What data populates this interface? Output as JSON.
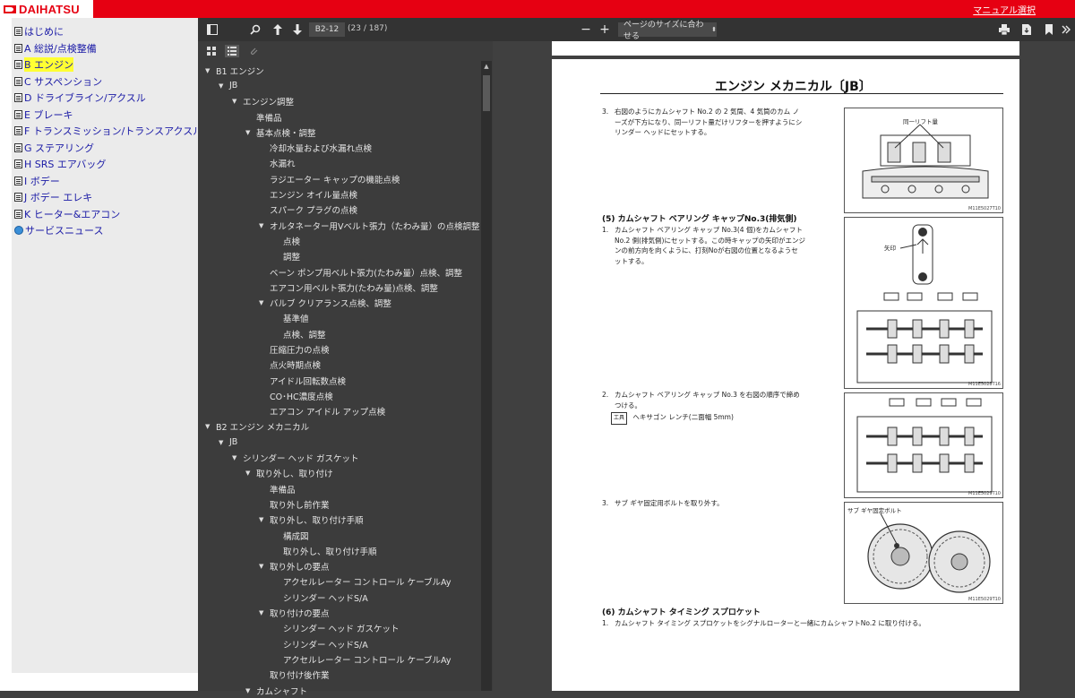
{
  "header": {
    "brand": "DAIHATSU",
    "manual_select": "マニュアル選択"
  },
  "left_nav": {
    "items": [
      {
        "label": "はじめに",
        "icon": "doc-icon",
        "active": false
      },
      {
        "label": "A 総説/点検整備",
        "icon": "doc-icon",
        "active": false
      },
      {
        "label": "B エンジン",
        "icon": "doc-icon",
        "active": true
      },
      {
        "label": "C サスペンション",
        "icon": "doc-icon",
        "active": false
      },
      {
        "label": "D ドライブライン/アクスル",
        "icon": "doc-icon",
        "active": false
      },
      {
        "label": "E ブレーキ",
        "icon": "doc-icon",
        "active": false
      },
      {
        "label": "F トランスミッション/トランスアクスル",
        "icon": "doc-icon",
        "active": false
      },
      {
        "label": "G ステアリング",
        "icon": "doc-icon",
        "active": false
      },
      {
        "label": "H SRS エアバッグ",
        "icon": "doc-icon",
        "active": false
      },
      {
        "label": "I ボデー",
        "icon": "doc-icon",
        "active": false
      },
      {
        "label": "J ボデー エレキ",
        "icon": "doc-icon",
        "active": false
      },
      {
        "label": "K ヒーター&エアコン",
        "icon": "doc-icon",
        "active": false
      },
      {
        "label": "サービスニュース",
        "icon": "globe-icon",
        "active": false
      }
    ]
  },
  "toolbar": {
    "page_label": "B2-12",
    "page_count": "(23 / 187)",
    "zoom_minus": "−",
    "zoom_plus": "+",
    "zoom_option": "ページのサイズに合わせる"
  },
  "outline": {
    "items": [
      {
        "label": "B1 エンジン",
        "level": 0,
        "expanded": true
      },
      {
        "label": "JB",
        "level": 1,
        "expanded": true
      },
      {
        "label": "エンジン調整",
        "level": 2,
        "expanded": true
      },
      {
        "label": "準備品",
        "level": 3,
        "expanded": null
      },
      {
        "label": "基本点検・調整",
        "level": 3,
        "expanded": true
      },
      {
        "label": "冷却水量および水漏れ点検",
        "level": 4,
        "expanded": null
      },
      {
        "label": "水漏れ",
        "level": 4,
        "expanded": null
      },
      {
        "label": "ラジエーター キャップの機能点検",
        "level": 4,
        "expanded": null
      },
      {
        "label": "エンジン オイル量点検",
        "level": 4,
        "expanded": null
      },
      {
        "label": "スパーク プラグの点検",
        "level": 4,
        "expanded": null
      },
      {
        "label": "オルタネーター用Vベルト張力（たわみ量）の点検調整",
        "level": 4,
        "expanded": true
      },
      {
        "label": "点検",
        "level": 5,
        "expanded": null
      },
      {
        "label": "調整",
        "level": 5,
        "expanded": null
      },
      {
        "label": "ベーン ポンプ用ベルト張力(たわみ量）点検、調整",
        "level": 4,
        "expanded": null
      },
      {
        "label": "エアコン用ベルト張力(たわみ量)点検、調整",
        "level": 4,
        "expanded": null
      },
      {
        "label": "バルブ クリアランス点検、調整",
        "level": 4,
        "expanded": true
      },
      {
        "label": "基準値",
        "level": 5,
        "expanded": null
      },
      {
        "label": "点検、調整",
        "level": 5,
        "expanded": null
      },
      {
        "label": "圧縮圧力の点検",
        "level": 4,
        "expanded": null
      },
      {
        "label": "点火時期点検",
        "level": 4,
        "expanded": null
      },
      {
        "label": "アイドル回転数点検",
        "level": 4,
        "expanded": null
      },
      {
        "label": "CO･HC濃度点検",
        "level": 4,
        "expanded": null
      },
      {
        "label": "エアコン アイドル アップ点検",
        "level": 4,
        "expanded": null
      },
      {
        "label": "B2 エンジン メカニカル",
        "level": 0,
        "expanded": true
      },
      {
        "label": "JB",
        "level": 1,
        "expanded": true
      },
      {
        "label": "シリンダー ヘッド ガスケット",
        "level": 2,
        "expanded": true
      },
      {
        "label": "取り外し、取り付け",
        "level": 3,
        "expanded": true
      },
      {
        "label": "準備品",
        "level": 4,
        "expanded": null
      },
      {
        "label": "取り外し前作業",
        "level": 4,
        "expanded": null
      },
      {
        "label": "取り外し、取り付け手順",
        "level": 4,
        "expanded": true
      },
      {
        "label": "構成図",
        "level": 5,
        "expanded": null
      },
      {
        "label": "取り外し、取り付け手順",
        "level": 5,
        "expanded": null
      },
      {
        "label": "取り外しの要点",
        "level": 4,
        "expanded": true
      },
      {
        "label": "アクセルレーター コントロール ケーブルAy",
        "level": 5,
        "expanded": null
      },
      {
        "label": "シリンダー ヘッドS/A",
        "level": 5,
        "expanded": null
      },
      {
        "label": "取り付けの要点",
        "level": 4,
        "expanded": true
      },
      {
        "label": "シリンダー ヘッド ガスケット",
        "level": 5,
        "expanded": null
      },
      {
        "label": "シリンダー ヘッドS/A",
        "level": 5,
        "expanded": null
      },
      {
        "label": "アクセルレーター コントロール ケーブルAy",
        "level": 5,
        "expanded": null
      },
      {
        "label": "取り付け後作業",
        "level": 4,
        "expanded": null
      },
      {
        "label": "カムシャフト",
        "level": 3,
        "expanded": true
      }
    ]
  },
  "document": {
    "title": "エンジン メカニカル〔JB〕",
    "step3_num": "3.",
    "step3_text_1": "右図のようにカムシャフト No.2 の 2 気筒、4 気筒のカム ノ",
    "step3_text_2": "ーズが下方になり、同一リフト量だけリフターを押すようにシ",
    "step3_text_3": "リンダー ヘッドにセットする。",
    "fig1_label": "同一リフト量",
    "fig1_code": "M11E5027T10",
    "sec5_heading": "(5)  カムシャフト ベアリング キャップNo.3(排気側)",
    "sec5_s1_num": "1.",
    "sec5_s1_text_1": "カムシャフト ベアリング キャップ No.3(4 個)をカムシャフト",
    "sec5_s1_text_2": "No.2 側(排気側)にセットする。この時キャップの矢印がエンジ",
    "sec5_s1_text_3": "ンの前方向を向くように、打刻Noが右図の位置となるようセ",
    "sec5_s1_text_4": "ットする。",
    "fig2_label": "矢印",
    "fig2_code": "M11E5028T16",
    "sec5_s2_num": "2.",
    "sec5_s2_text_1": "カムシャフト ベアリング キャップ No.3 を右図の順序で締め",
    "sec5_s2_text_2": "つける。",
    "tool_tag": "工具",
    "tool_text": "ヘキサゴン レンチ(二面幅 5mm)",
    "fig3_code": "M11E5029T10",
    "sec5_s3_num": "3.",
    "sec5_s3_text": "サブ ギヤ固定用ボルトを取り外す。",
    "fig4_label": "サブ  ギヤ固定ボルト",
    "fig4_code": "M11E5029T10",
    "sec6_heading": "(6)  カムシャフト タイミング スプロケット",
    "sec6_s1_num": "1.",
    "sec6_s1_text": "カムシャフト タイミング スプロケットをシグナルローターと一緒にカムシャフトNo.2 に取り付ける。"
  },
  "colors": {
    "brand_red": "#e60012",
    "toolbar_bg": "#333333",
    "outline_bg": "#3c3c3c",
    "nav_link": "#1a1aa6",
    "highlight": "#ffff33"
  }
}
